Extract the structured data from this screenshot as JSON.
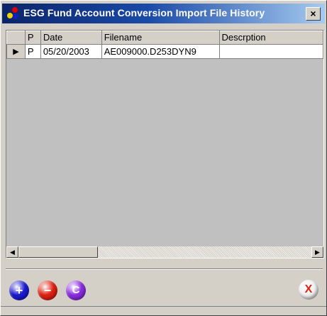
{
  "window": {
    "title": "ESG Fund Account Conversion Import File History",
    "close_label": "×"
  },
  "grid": {
    "columns": [
      "P",
      "Date",
      "Filename",
      "Descrption"
    ],
    "rows": [
      {
        "indicator": "▶",
        "p": "P",
        "date": "05/20/2003",
        "filename": "AE009000.D253DYN9",
        "description": ""
      }
    ],
    "scroll_left": "◀",
    "scroll_right": "▶"
  },
  "toolbar": {
    "add_label": "+",
    "delete_label": "−",
    "c_label": "C",
    "exit_label": "X"
  },
  "colors": {
    "add": "#1a1ad0",
    "delete": "#e02010",
    "c": "#8a2be2",
    "exit_text": "#e02010"
  }
}
